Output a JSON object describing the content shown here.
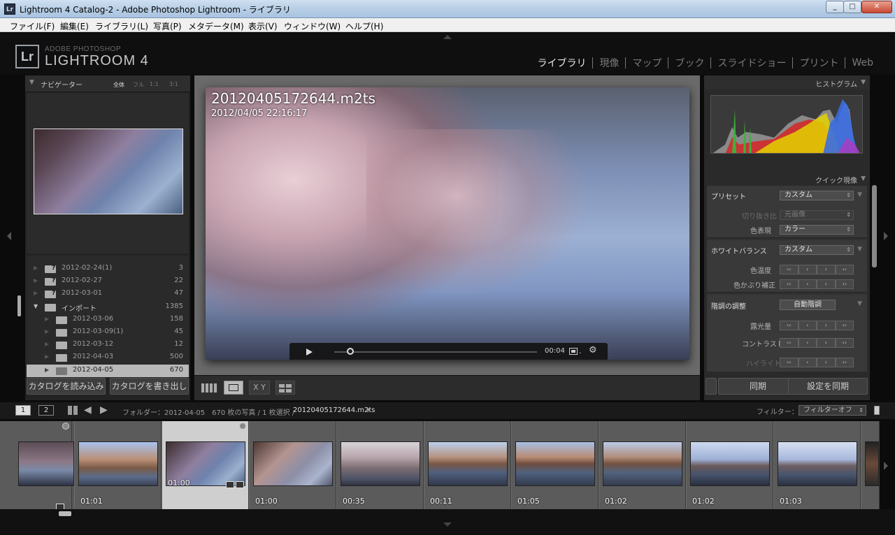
{
  "window": {
    "title": "Lightroom 4 Catalog-2 - Adobe Photoshop Lightroom - ライブラリ",
    "app_icon": "Lr"
  },
  "menu": [
    "ファイル(F)",
    "編集(E)",
    "ライブラリ(L)",
    "写真(P)",
    "メタデータ(M)",
    "表示(V)",
    "ウィンドウ(W)",
    "ヘルプ(H)"
  ],
  "brand": {
    "small": "ADOBE PHOTOSHOP",
    "large": "LIGHTROOM 4",
    "logo": "Lr"
  },
  "modules": [
    "ライブラリ",
    "現像",
    "マップ",
    "ブック",
    "スライドショー",
    "プリント",
    "Web"
  ],
  "active_module": "ライブラリ",
  "navigator": {
    "title": "ナビゲーター",
    "zoom": [
      "全体",
      "フル",
      "1:1",
      "3:1"
    ]
  },
  "folders": [
    {
      "name": "2012-02-24(1)",
      "count": "3",
      "missing": true
    },
    {
      "name": "2012-02-27",
      "count": "22",
      "missing": true
    },
    {
      "name": "2012-03-01",
      "count": "47",
      "missing": true
    },
    {
      "name": "インポート",
      "count": "1385",
      "parent": true
    },
    {
      "name": "2012-03-06",
      "count": "158"
    },
    {
      "name": "2012-03-09(1)",
      "count": "45"
    },
    {
      "name": "2012-03-12",
      "count": "12"
    },
    {
      "name": "2012-04-03",
      "count": "500"
    },
    {
      "name": "2012-04-05",
      "count": "670",
      "selected": true
    }
  ],
  "left_buttons": {
    "import": "カタログを読み込み",
    "export": "カタログを書き出し"
  },
  "loupe": {
    "filename": "20120405172644.m2ts",
    "datetime": "2012/04/05 22:16:17",
    "video_time": "00:04",
    "progress": 0.08,
    "video_dot": "."
  },
  "histogram": {
    "title": "ヒストグラム"
  },
  "quick_develop": {
    "title": "クイック現像",
    "preset_label": "プリセット",
    "preset_value": "カスタム",
    "crop_label": "切り抜き比",
    "crop_value": "元画像",
    "treatment_label": "色表現",
    "treatment_value": "カラー",
    "wb_label": "ホワイトバランス",
    "wb_value": "カスタム",
    "temp_label": "色温度",
    "tint_label": "色かぶり補正",
    "tone_label": "階調の調整",
    "auto_tone": "自動階調",
    "exposure_label": "露光量",
    "contrast_label": "コントラスト",
    "highlights_label": "ハイライト",
    "stepper": [
      "‹‹",
      "‹",
      "›",
      "››"
    ]
  },
  "right_buttons": {
    "sync": "同期",
    "sync_settings": "設定を同期"
  },
  "toolbar": {
    "compare": "X Y"
  },
  "filmstrip_bar": {
    "page1": "1",
    "page2": "2",
    "path_prefix": "フォルダー：2012-04-05　670 枚の写真 / 1 枚選択 /",
    "current_file": "20120405172644.m2ts",
    "filter_label": "フィルター：",
    "filter_value": "フィルターオフ"
  },
  "filmstrip": [
    {
      "duration": ""
    },
    {
      "duration": "01:01"
    },
    {
      "duration": "01:00",
      "selected": true
    },
    {
      "duration": "01:00"
    },
    {
      "duration": "00:35"
    },
    {
      "duration": "00:11"
    },
    {
      "duration": "01:05"
    },
    {
      "duration": "01:02"
    },
    {
      "duration": "01:02"
    },
    {
      "duration": "01:03"
    }
  ]
}
